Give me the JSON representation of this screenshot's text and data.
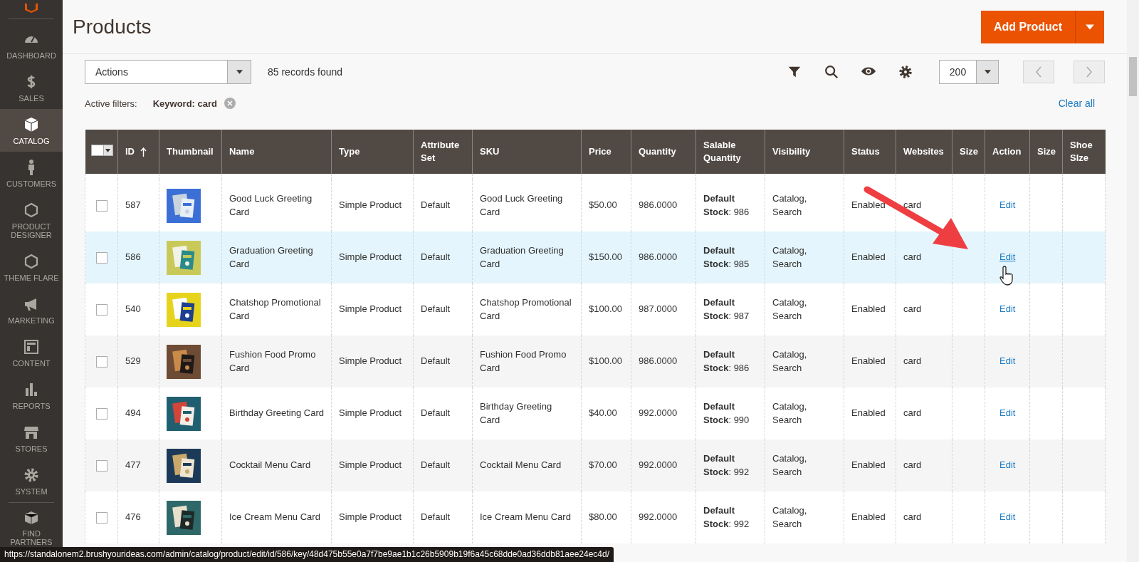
{
  "sidebar": {
    "items": [
      {
        "label": "DASHBOARD",
        "selected": false
      },
      {
        "label": "SALES",
        "selected": false
      },
      {
        "label": "CATALOG",
        "selected": true
      },
      {
        "label": "CUSTOMERS",
        "selected": false
      },
      {
        "label": "PRODUCT DESIGNER",
        "selected": false
      },
      {
        "label": "THEME FLARE",
        "selected": false
      },
      {
        "label": "MARKETING",
        "selected": false
      },
      {
        "label": "CONTENT",
        "selected": false
      },
      {
        "label": "REPORTS",
        "selected": false
      },
      {
        "label": "STORES",
        "selected": false
      },
      {
        "label": "SYSTEM",
        "selected": false
      },
      {
        "label": "FIND PARTNERS",
        "selected": false
      }
    ]
  },
  "page_title": "Products",
  "add_button": {
    "label": "Add Product"
  },
  "toolbar": {
    "actions_select": "Actions",
    "records": "85 records found",
    "per_page": "200"
  },
  "filters": {
    "label": "Active filters:",
    "chips": [
      {
        "text": "Keyword: card"
      }
    ],
    "clear": "Clear all"
  },
  "table": {
    "columns": [
      {
        "kind": "select"
      },
      {
        "kind": "text",
        "label": "ID",
        "sorted": true
      },
      {
        "kind": "text",
        "label": "Thumbnail"
      },
      {
        "kind": "text",
        "label": "Name"
      },
      {
        "kind": "text",
        "label": "Type"
      },
      {
        "kind": "text",
        "label": "Attribute Set"
      },
      {
        "kind": "text",
        "label": "SKU"
      },
      {
        "kind": "text",
        "label": "Price"
      },
      {
        "kind": "text",
        "label": "Quantity"
      },
      {
        "kind": "text",
        "label": "Salable Quantity"
      },
      {
        "kind": "text",
        "label": "Visibility"
      },
      {
        "kind": "text",
        "label": "Status"
      },
      {
        "kind": "text",
        "label": "Websites"
      },
      {
        "kind": "text",
        "label": "Size"
      },
      {
        "kind": "text",
        "label": "Action"
      },
      {
        "kind": "text",
        "label": "Size"
      },
      {
        "kind": "text",
        "label": "Shoe SIze"
      }
    ],
    "rows": [
      {
        "checked": false,
        "highlighted": false,
        "id": "587",
        "name": "Good Luck Greeting Card",
        "type": "Simple Product",
        "attribute_set": "Default",
        "sku": "Good Luck Greeting Card",
        "price": "$50.00",
        "quantity": "986.0000",
        "salable": "**Default Stock**: 986",
        "visibility": "Catalog, Search",
        "status": "Enabled",
        "websites": "card",
        "action": "Edit"
      },
      {
        "checked": false,
        "highlighted": true,
        "id": "586",
        "name": "Graduation Greeting Card",
        "type": "Simple Product",
        "attribute_set": "Default",
        "sku": "Graduation Greeting Card",
        "price": "$150.00",
        "quantity": "986.0000",
        "salable": "**Default Stock**: 985",
        "visibility": "Catalog, Search",
        "status": "Enabled",
        "websites": "card",
        "action": "Edit"
      },
      {
        "checked": false,
        "highlighted": false,
        "id": "540",
        "name": "Chatshop Promotional Card",
        "type": "Simple Product",
        "attribute_set": "Default",
        "sku": "Chatshop Promotional Card",
        "price": "$100.00",
        "quantity": "987.0000",
        "salable": "**Default Stock**: 987",
        "visibility": "Catalog, Search",
        "status": "Enabled",
        "websites": "card",
        "action": "Edit"
      },
      {
        "checked": false,
        "highlighted": false,
        "id": "529",
        "name": "Fushion Food Promo Card",
        "type": "Simple Product",
        "attribute_set": "Default",
        "sku": "Fushion Food Promo Card",
        "price": "$100.00",
        "quantity": "986.0000",
        "salable": "**Default Stock**: 986",
        "visibility": "Catalog, Search",
        "status": "Enabled",
        "websites": "card",
        "action": "Edit"
      },
      {
        "checked": false,
        "highlighted": false,
        "id": "494",
        "name": "Birthday Greeting Card",
        "type": "Simple Product",
        "attribute_set": "Default",
        "sku": "Birthday Greeting Card",
        "price": "$40.00",
        "quantity": "992.0000",
        "salable": "**Default Stock**: 990",
        "visibility": "Catalog, Search",
        "status": "Enabled",
        "websites": "card",
        "action": "Edit"
      },
      {
        "checked": false,
        "highlighted": false,
        "id": "477",
        "name": "Cocktail Menu Card",
        "type": "Simple Product",
        "attribute_set": "Default",
        "sku": "Cocktail Menu Card",
        "price": "$70.00",
        "quantity": "992.0000",
        "salable": "**Default Stock**: 992",
        "visibility": "Catalog, Search",
        "status": "Enabled",
        "websites": "card",
        "action": "Edit"
      },
      {
        "checked": false,
        "highlighted": false,
        "id": "476",
        "name": "Ice Cream Menu Card",
        "type": "Simple Product",
        "attribute_set": "Default",
        "sku": "Ice Cream Menu Card",
        "price": "$80.00",
        "quantity": "992.0000",
        "salable": "**Default Stock**: 992",
        "visibility": "Catalog, Search",
        "status": "Enabled",
        "websites": "card",
        "action": "Edit"
      }
    ]
  },
  "status_bar": {
    "url": "https://standalonem2.brushyourideas.com/admin/catalog/product/edit/id/586/key/48d475b55e0a7f7be9ae1b1c26b5909b19f6a45c68dde0ad36ddb81aee24ec4d/"
  }
}
